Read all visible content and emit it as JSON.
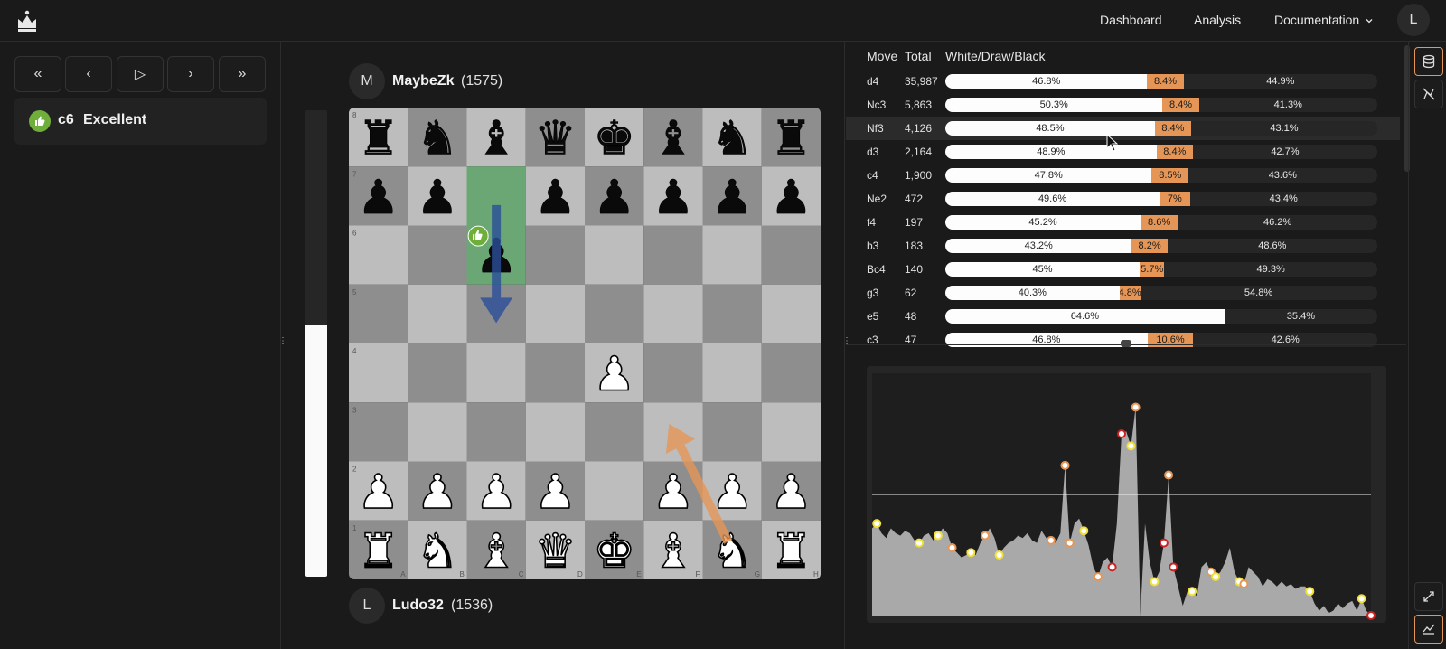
{
  "nav": {
    "links": [
      "Dashboard",
      "Analysis",
      "Documentation"
    ],
    "documentation_chevron": "chevron-down-icon",
    "user_initial": "L"
  },
  "controls": {
    "first": "«",
    "prev": "‹",
    "play": "▷",
    "next": "›",
    "last": "»"
  },
  "current_move": {
    "san": "c6",
    "quality": "Excellent",
    "quality_color": "#6fae3a",
    "icon": "thumbs-up-icon"
  },
  "players": {
    "top": {
      "initial": "M",
      "name": "MaybeZk",
      "rating": "(1575)"
    },
    "bottom": {
      "initial": "L",
      "name": "Ludo32",
      "rating": "(1536)"
    }
  },
  "eval_bar": {
    "white_fraction": 0.54
  },
  "board": {
    "ranks": [
      "8",
      "7",
      "6",
      "5",
      "4",
      "3",
      "2",
      "1"
    ],
    "files": [
      "A",
      "B",
      "C",
      "D",
      "E",
      "F",
      "G",
      "H"
    ],
    "position": [
      [
        "r",
        "n",
        "b",
        "q",
        "k",
        "b",
        "n",
        "r"
      ],
      [
        "p",
        "p",
        "",
        "p",
        "p",
        "p",
        "p",
        "p"
      ],
      [
        "",
        "",
        "p",
        "",
        "",
        "",
        "",
        ""
      ],
      [
        "",
        "",
        "",
        "",
        "",
        "",
        "",
        ""
      ],
      [
        "",
        "",
        "",
        "",
        "P",
        "",
        "",
        ""
      ],
      [
        "",
        "",
        "",
        "",
        "",
        "",
        "",
        ""
      ],
      [
        "P",
        "P",
        "P",
        "P",
        "",
        "P",
        "P",
        "P"
      ],
      [
        "R",
        "N",
        "B",
        "Q",
        "K",
        "B",
        "N",
        "R"
      ]
    ],
    "highlight_squares": [
      "c7",
      "c6"
    ],
    "arrows": [
      {
        "from": "c7",
        "to": "c5",
        "color": "#2a4f9a"
      },
      {
        "from": "g1",
        "to": "f3",
        "color": "#e59657"
      }
    ],
    "colors": {
      "light": "#bdbdbd",
      "dark": "#8e8e8e",
      "highlight": "#6aa774"
    }
  },
  "explorer": {
    "headers": {
      "move": "Move",
      "total": "Total",
      "wdb": "White/Draw/Black"
    },
    "rows": [
      {
        "move": "d4",
        "total": "35,987",
        "white": 46.8,
        "draw": 8.4,
        "black": 44.9,
        "wl": "46.8%",
        "dl": "8.4%",
        "bl": "44.9%"
      },
      {
        "move": "Nc3",
        "total": "5,863",
        "white": 50.3,
        "draw": 8.4,
        "black": 41.3,
        "wl": "50.3%",
        "dl": "8.4%",
        "bl": "41.3%"
      },
      {
        "move": "Nf3",
        "total": "4,126",
        "white": 48.5,
        "draw": 8.4,
        "black": 43.1,
        "wl": "48.5%",
        "dl": "8.4%",
        "bl": "43.1%"
      },
      {
        "move": "d3",
        "total": "2,164",
        "white": 48.9,
        "draw": 8.4,
        "black": 42.7,
        "wl": "48.9%",
        "dl": "8.4%",
        "bl": "42.7%"
      },
      {
        "move": "c4",
        "total": "1,900",
        "white": 47.8,
        "draw": 8.5,
        "black": 43.6,
        "wl": "47.8%",
        "dl": "8.5%",
        "bl": "43.6%"
      },
      {
        "move": "Ne2",
        "total": "472",
        "white": 49.6,
        "draw": 7.0,
        "black": 43.4,
        "wl": "49.6%",
        "dl": "7%",
        "bl": "43.4%"
      },
      {
        "move": "f4",
        "total": "197",
        "white": 45.2,
        "draw": 8.6,
        "black": 46.2,
        "wl": "45.2%",
        "dl": "8.6%",
        "bl": "46.2%"
      },
      {
        "move": "b3",
        "total": "183",
        "white": 43.2,
        "draw": 8.2,
        "black": 48.6,
        "wl": "43.2%",
        "dl": "8.2%",
        "bl": "48.6%"
      },
      {
        "move": "Bc4",
        "total": "140",
        "white": 45.0,
        "draw": 5.7,
        "black": 49.3,
        "wl": "45%",
        "dl": "5.7%",
        "bl": "49.3%"
      },
      {
        "move": "g3",
        "total": "62",
        "white": 40.3,
        "draw": 4.8,
        "black": 54.8,
        "wl": "40.3%",
        "dl": "4.8%",
        "bl": "54.8%"
      },
      {
        "move": "e5",
        "total": "48",
        "white": 64.6,
        "draw": 0,
        "black": 35.4,
        "wl": "64.6%",
        "dl": "",
        "bl": "35.4%"
      },
      {
        "move": "c3",
        "total": "47",
        "white": 46.8,
        "draw": 10.6,
        "black": 42.6,
        "wl": "46.8%",
        "dl": "10.6%",
        "bl": "42.6%"
      }
    ],
    "highlighted_row": 2
  },
  "eval_graph": {
    "values": [
      0.36,
      0.38,
      0.34,
      0.32,
      0.36,
      0.34,
      0.33,
      0.35,
      0.34,
      0.31,
      0.3,
      0.33,
      0.34,
      0.31,
      0.33,
      0.36,
      0.34,
      0.28,
      0.26,
      0.24,
      0.25,
      0.26,
      0.25,
      0.3,
      0.33,
      0.36,
      0.32,
      0.25,
      0.28,
      0.3,
      0.31,
      0.33,
      0.32,
      0.34,
      0.31,
      0.3,
      0.35,
      0.32,
      0.31,
      0.3,
      0.34,
      0.62,
      0.3,
      0.38,
      0.4,
      0.35,
      0.29,
      0.2,
      0.16,
      0.22,
      0.24,
      0.2,
      0.38,
      0.75,
      0.76,
      0.7,
      0.86,
      0.0,
      0.38,
      0.22,
      0.14,
      0.18,
      0.3,
      0.58,
      0.2,
      0.12,
      0.04,
      0.1,
      0.1,
      0.08,
      0.2,
      0.22,
      0.18,
      0.16,
      0.18,
      0.22,
      0.28,
      0.18,
      0.14,
      0.13,
      0.2,
      0.18,
      0.16,
      0.12,
      0.15,
      0.14,
      0.12,
      0.14,
      0.12,
      0.13,
      0.11,
      0.12,
      0.12,
      0.1,
      0.05,
      0.02,
      0.04,
      0.01,
      0.02,
      0.05,
      0.03,
      0.05,
      0.06,
      0.02,
      0.07,
      0.02,
      0.0
    ],
    "markers": [
      {
        "i": 1,
        "color": "#f2e03a"
      },
      {
        "i": 10,
        "color": "#f2e03a"
      },
      {
        "i": 14,
        "color": "#f2e03a"
      },
      {
        "i": 17,
        "color": "#e59657"
      },
      {
        "i": 21,
        "color": "#f2e03a"
      },
      {
        "i": 24,
        "color": "#e59657"
      },
      {
        "i": 27,
        "color": "#f2e03a"
      },
      {
        "i": 38,
        "color": "#e59657"
      },
      {
        "i": 41,
        "color": "#e59657"
      },
      {
        "i": 42,
        "color": "#e59657"
      },
      {
        "i": 45,
        "color": "#f2e03a"
      },
      {
        "i": 48,
        "color": "#e59657"
      },
      {
        "i": 51,
        "color": "#cc2222"
      },
      {
        "i": 53,
        "color": "#cc2222"
      },
      {
        "i": 55,
        "color": "#f2e03a"
      },
      {
        "i": 56,
        "color": "#e59657"
      },
      {
        "i": 60,
        "color": "#f2e03a"
      },
      {
        "i": 62,
        "color": "#cc2222"
      },
      {
        "i": 63,
        "color": "#e59657"
      },
      {
        "i": 64,
        "color": "#cc2222"
      },
      {
        "i": 68,
        "color": "#f2e03a"
      },
      {
        "i": 72,
        "color": "#e59657"
      },
      {
        "i": 73,
        "color": "#f2e03a"
      },
      {
        "i": 78,
        "color": "#f2e03a"
      },
      {
        "i": 79,
        "color": "#e59657"
      },
      {
        "i": 93,
        "color": "#f2e03a"
      },
      {
        "i": 104,
        "color": "#f2e03a"
      },
      {
        "i": 106,
        "color": "#cc2222"
      }
    ],
    "midline": 0.5
  },
  "sidebar": {
    "icons": [
      "database-icon",
      "engine-off-icon",
      "expand-icon",
      "chart-icon"
    ]
  }
}
